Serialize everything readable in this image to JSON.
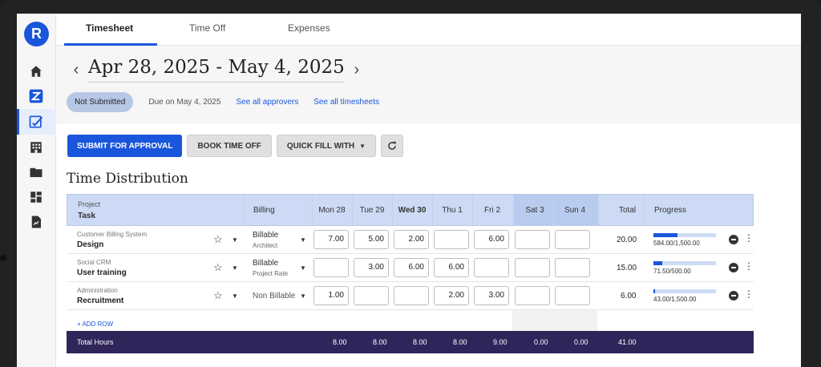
{
  "app": {
    "logo_letter": "R"
  },
  "tabs": [
    {
      "label": "Timesheet",
      "active": true
    },
    {
      "label": "Time Off",
      "active": false
    },
    {
      "label": "Expenses",
      "active": false
    }
  ],
  "sidebar_icons": [
    "home-icon",
    "z-app-icon",
    "timesheet-icon",
    "building-icon",
    "folder-icon",
    "dashboard-icon",
    "report-icon"
  ],
  "header": {
    "prev": "‹",
    "next": "›",
    "date_range": "Apr 28, 2025 - May 4, 2025",
    "status": "Not Submitted",
    "due": "Due on May 4, 2025",
    "link_approvers": "See all approvers",
    "link_timesheets": "See all timesheets"
  },
  "actions": {
    "submit": "SUBMIT FOR APPROVAL",
    "book_time_off": "BOOK TIME OFF",
    "quick_fill": "QUICK FILL WITH"
  },
  "section_title": "Time Distribution",
  "table": {
    "headers": {
      "project": "Project",
      "task": "Task",
      "billing": "Billing",
      "days": [
        "Mon 28",
        "Tue 29",
        "Wed 30",
        "Thu 1",
        "Fri 2",
        "Sat 3",
        "Sun 4"
      ],
      "total": "Total",
      "progress": "Progress"
    },
    "rows": [
      {
        "project": "Customer Billing System",
        "task": "Design",
        "billing": "Billable",
        "billing_sub": "Architect",
        "hours": [
          "7.00",
          "5.00",
          "2.00",
          "",
          "6.00",
          "",
          ""
        ],
        "total": "20.00",
        "progress_text": "584.00/1,500.00",
        "progress_fraction": 0.39
      },
      {
        "project": "Social CRM",
        "task": "User training",
        "billing": "Billable",
        "billing_sub": "Project Rate",
        "hours": [
          "",
          "3.00",
          "6.00",
          "6.00",
          "",
          "",
          ""
        ],
        "total": "15.00",
        "progress_text": "71.50/500.00",
        "progress_fraction": 0.14
      },
      {
        "project": "Administration",
        "task": "Recruitment",
        "billing": "Non Billable",
        "billing_sub": "",
        "hours": [
          "1.00",
          "",
          "",
          "2.00",
          "3.00",
          "",
          ""
        ],
        "total": "6.00",
        "progress_text": "43.00/1,500.00",
        "progress_fraction": 0.03
      }
    ],
    "add_row": "+ ADD ROW",
    "footer": {
      "label": "Total Hours",
      "day_totals": [
        "8.00",
        "8.00",
        "8.00",
        "8.00",
        "9.00",
        "0.00",
        "0.00"
      ],
      "grand_total": "41.00"
    }
  },
  "colors": {
    "primary": "#1a56db",
    "header_bg": "#ccdaf5",
    "footer_bg": "#30255a",
    "status_badge": "#b7c8e6"
  }
}
